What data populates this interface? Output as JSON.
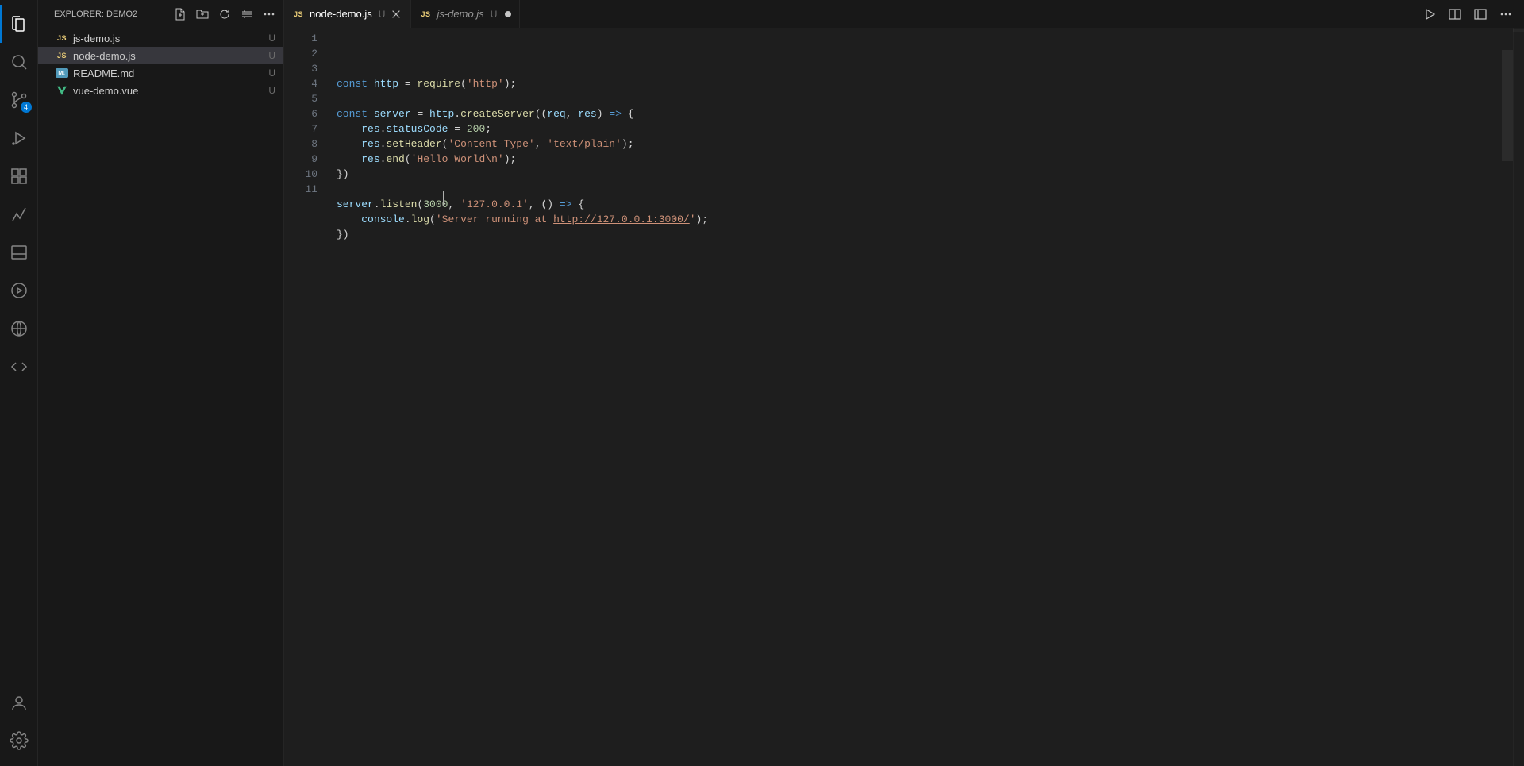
{
  "sidebar": {
    "title": "EXPLORER: DEMO2",
    "scm_badge": "4",
    "files": [
      {
        "icon": "js",
        "name": "js-demo.js",
        "status": "U",
        "selected": false
      },
      {
        "icon": "js",
        "name": "node-demo.js",
        "status": "U",
        "selected": true
      },
      {
        "icon": "md",
        "name": "README.md",
        "status": "U",
        "selected": false
      },
      {
        "icon": "vue",
        "name": "vue-demo.vue",
        "status": "U",
        "selected": false
      }
    ]
  },
  "tabs": [
    {
      "icon": "js",
      "name": "node-demo.js",
      "status": "U",
      "active": true,
      "dirty": false
    },
    {
      "icon": "js",
      "name": "js-demo.js",
      "status": "U",
      "active": false,
      "dirty": true
    }
  ],
  "editor": {
    "lines": [
      [
        {
          "t": "k",
          "v": "const"
        },
        {
          "t": "",
          "v": " "
        },
        {
          "t": "v",
          "v": "http"
        },
        {
          "t": "",
          "v": " = "
        },
        {
          "t": "fn",
          "v": "require"
        },
        {
          "t": "",
          "v": "("
        },
        {
          "t": "s",
          "v": "'http'"
        },
        {
          "t": "",
          "v": ");"
        }
      ],
      [],
      [
        {
          "t": "k",
          "v": "const"
        },
        {
          "t": "",
          "v": " "
        },
        {
          "t": "v",
          "v": "server"
        },
        {
          "t": "",
          "v": " = "
        },
        {
          "t": "v",
          "v": "http"
        },
        {
          "t": "",
          "v": "."
        },
        {
          "t": "fn",
          "v": "createServer"
        },
        {
          "t": "",
          "v": "(("
        },
        {
          "t": "v",
          "v": "req"
        },
        {
          "t": "",
          "v": ", "
        },
        {
          "t": "v",
          "v": "res"
        },
        {
          "t": "",
          "v": ") "
        },
        {
          "t": "k",
          "v": "=>"
        },
        {
          "t": "",
          "v": " {"
        }
      ],
      [
        {
          "t": "",
          "v": "    "
        },
        {
          "t": "v",
          "v": "res"
        },
        {
          "t": "",
          "v": "."
        },
        {
          "t": "v",
          "v": "statusCode"
        },
        {
          "t": "",
          "v": " = "
        },
        {
          "t": "n",
          "v": "200"
        },
        {
          "t": "",
          "v": ";"
        }
      ],
      [
        {
          "t": "",
          "v": "    "
        },
        {
          "t": "v",
          "v": "res"
        },
        {
          "t": "",
          "v": "."
        },
        {
          "t": "fn",
          "v": "setHeader"
        },
        {
          "t": "",
          "v": "("
        },
        {
          "t": "s",
          "v": "'Content-Type'"
        },
        {
          "t": "",
          "v": ", "
        },
        {
          "t": "s",
          "v": "'text/plain'"
        },
        {
          "t": "",
          "v": ");"
        }
      ],
      [
        {
          "t": "",
          "v": "    "
        },
        {
          "t": "v",
          "v": "res"
        },
        {
          "t": "",
          "v": "."
        },
        {
          "t": "fn",
          "v": "end"
        },
        {
          "t": "",
          "v": "("
        },
        {
          "t": "s",
          "v": "'Hello World\\n'"
        },
        {
          "t": "",
          "v": ");"
        }
      ],
      [
        {
          "t": "",
          "v": "})"
        }
      ],
      [],
      [
        {
          "t": "v",
          "v": "server"
        },
        {
          "t": "",
          "v": "."
        },
        {
          "t": "fn",
          "v": "listen"
        },
        {
          "t": "",
          "v": "("
        },
        {
          "t": "n",
          "v": "3000"
        },
        {
          "t": "",
          "v": ", "
        },
        {
          "t": "s",
          "v": "'127.0.0.1'"
        },
        {
          "t": "",
          "v": ", () "
        },
        {
          "t": "k",
          "v": "=>"
        },
        {
          "t": "",
          "v": " {"
        }
      ],
      [
        {
          "t": "",
          "v": "    "
        },
        {
          "t": "v",
          "v": "console"
        },
        {
          "t": "",
          "v": "."
        },
        {
          "t": "fn",
          "v": "log"
        },
        {
          "t": "",
          "v": "("
        },
        {
          "t": "s",
          "v": "'Server running at "
        },
        {
          "t": "u",
          "v": "http://127.0.0.1:3000/"
        },
        {
          "t": "s",
          "v": "'"
        },
        {
          "t": "",
          "v": ");"
        }
      ],
      [
        {
          "t": "",
          "v": "})"
        }
      ]
    ]
  }
}
